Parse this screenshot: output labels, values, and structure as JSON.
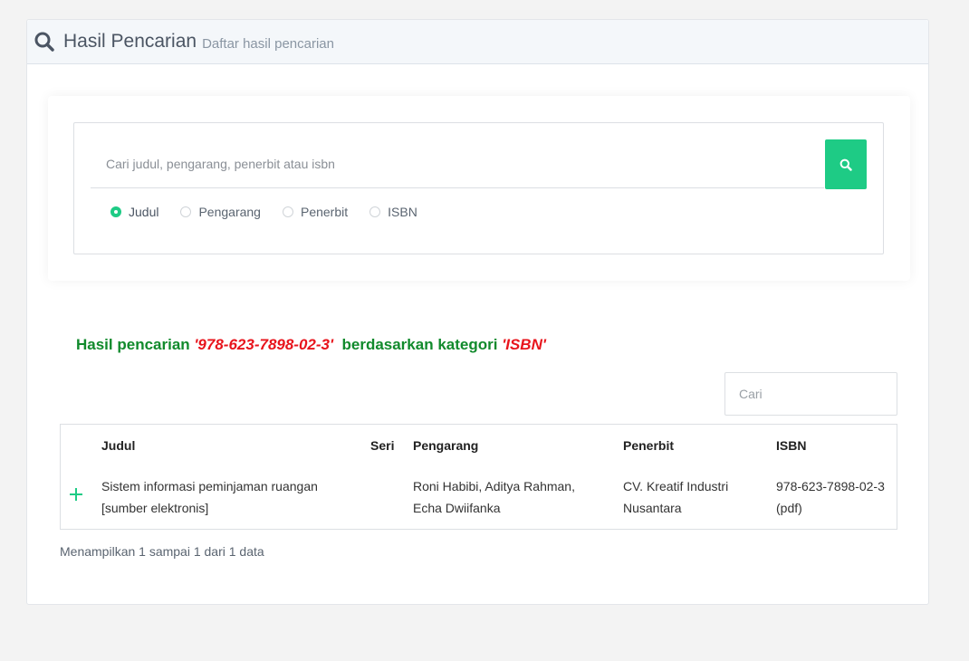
{
  "header": {
    "title": "Hasil Pencarian",
    "subtitle": "Daftar hasil pencarian",
    "icon": "search-icon"
  },
  "search": {
    "placeholder": "Cari judul, pengarang, penerbit atau isbn",
    "value": "",
    "button_icon": "search-icon",
    "options": [
      {
        "label": "Judul",
        "checked": true
      },
      {
        "label": "Pengarang",
        "checked": false
      },
      {
        "label": "Penerbit",
        "checked": false
      },
      {
        "label": "ISBN",
        "checked": false
      }
    ]
  },
  "result": {
    "prefix": "Hasil pencarian ",
    "query": "'978-623-7898-02-3'",
    "middle": "berdasarkan kategori ",
    "category": "'ISBN'"
  },
  "filter": {
    "placeholder": "Cari",
    "value": ""
  },
  "table": {
    "columns": [
      "Judul",
      "Seri",
      "Pengarang",
      "Penerbit",
      "ISBN"
    ],
    "rows": [
      {
        "judul_line1": "Sistem informasi peminjaman ruangan",
        "judul_line2": "[sumber elektronis]",
        "seri": "",
        "pengarang_line1": "Roni Habibi, Aditya Rahman,",
        "pengarang_line2": "Echa Dwiifanka",
        "penerbit_line1": "CV. Kreatif Industri",
        "penerbit_line2": "Nusantara",
        "isbn_line1": "978-623-7898-02-3",
        "isbn_line2": "(pdf)"
      }
    ]
  },
  "info": "Menampilkan 1 sampai 1 dari 1 data",
  "colors": {
    "accent": "#1ecb85",
    "heading_green": "#118a2c",
    "query_red": "#e8141c"
  }
}
